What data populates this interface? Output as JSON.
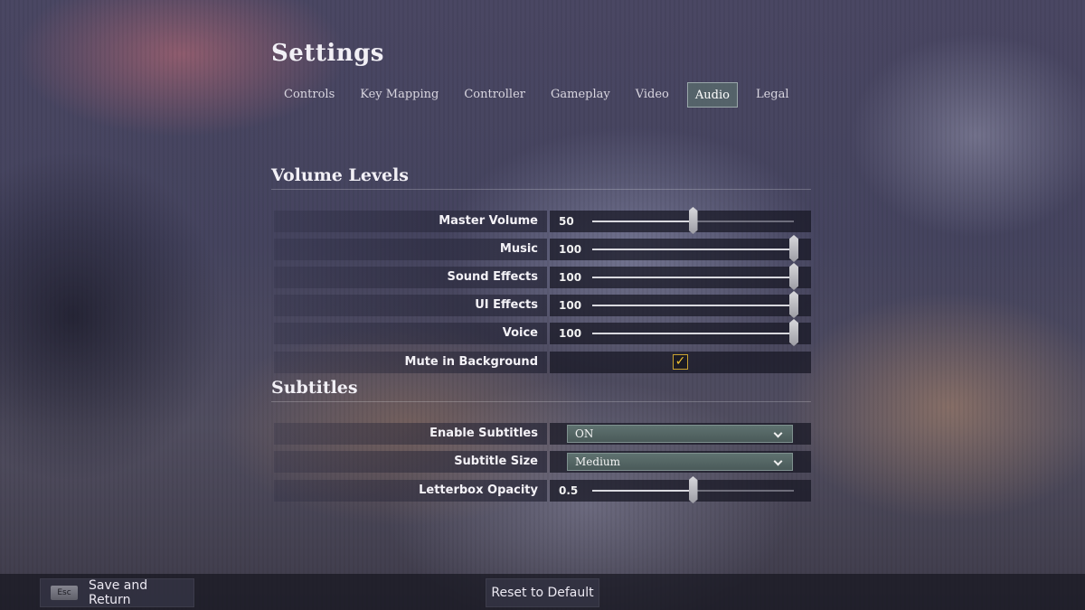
{
  "header": {
    "title": "Settings",
    "tabs": [
      {
        "label": "Controls"
      },
      {
        "label": "Key Mapping"
      },
      {
        "label": "Controller"
      },
      {
        "label": "Gameplay"
      },
      {
        "label": "Video"
      },
      {
        "label": "Audio",
        "active": true
      },
      {
        "label": "Legal"
      }
    ]
  },
  "volume": {
    "section_title": "Volume Levels",
    "master": {
      "label": "Master Volume",
      "value": "50",
      "fraction": 0.5
    },
    "music": {
      "label": "Music",
      "value": "100",
      "fraction": 1.0
    },
    "sound_effects": {
      "label": "Sound Effects",
      "value": "100",
      "fraction": 1.0
    },
    "ui_effects": {
      "label": "UI Effects",
      "value": "100",
      "fraction": 1.0
    },
    "voice": {
      "label": "Voice",
      "value": "100",
      "fraction": 1.0
    },
    "mute_in_background": {
      "label": "Mute in Background",
      "checked": true
    }
  },
  "subtitles": {
    "section_title": "Subtitles",
    "enable": {
      "label": "Enable Subtitles",
      "value": "ON"
    },
    "size": {
      "label": "Subtitle Size",
      "value": "Medium"
    },
    "letterbox_opacity": {
      "label": "Letterbox Opacity",
      "value": "0.5",
      "fraction": 0.5
    }
  },
  "footer": {
    "esc_key": "Esc",
    "save_return_label": "Save and Return",
    "reset_label": "Reset to Default"
  },
  "colors": {
    "accent_checkbox": "#f1c232",
    "tab_active_bg": "#5a6e6e",
    "dropdown_bg": "#56686a"
  }
}
